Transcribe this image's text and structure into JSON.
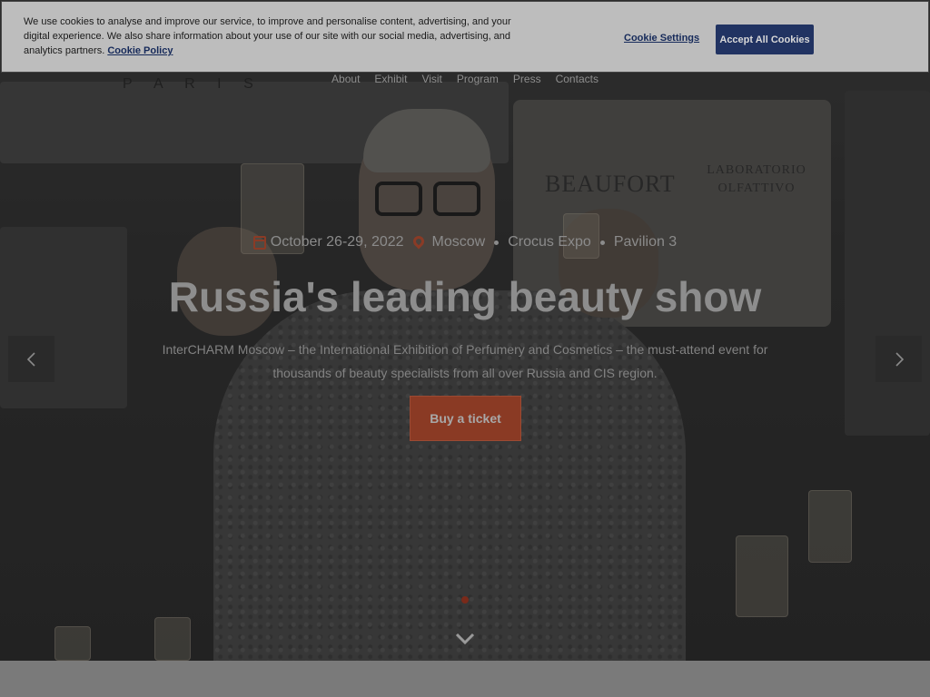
{
  "nav": {
    "items": [
      "About",
      "Exhibit",
      "Visit",
      "Program",
      "Press",
      "Contacts"
    ]
  },
  "background": {
    "paris_text": "P A R I S",
    "brand_1": "BEAUFORT",
    "brand_2": "LABORATORIO OLFATTIVO"
  },
  "hero": {
    "date": "October 26-29, 2022",
    "city": "Moscow",
    "venue": "Crocus Expo",
    "pavilion": "Pavilion 3",
    "headline": "Russia's leading beauty show",
    "description": "InterCHARM Moscow – the International Exhibition of Perfumery and Cosmetics – the must-attend event for thousands of beauty specialists from all over Russia and CIS region.",
    "cta_label": "Buy a ticket",
    "icons": {
      "date": "calendar-icon",
      "location": "map-pin-icon",
      "prev": "chevron-left-icon",
      "next": "chevron-right-icon",
      "scroll": "chevron-down-icon"
    }
  },
  "cookie_banner": {
    "text": "We use cookies to analyse and improve our service, to improve and personalise content, advertising, and your digital experience. We also share information about your use of our site with our social media, advertising, and analytics partners.",
    "policy_link": "Cookie Policy",
    "settings_label": "Cookie Settings",
    "accept_label": "Accept All Cookies"
  },
  "colors": {
    "accent": "#c8502e",
    "cookie_button": "#213362"
  }
}
